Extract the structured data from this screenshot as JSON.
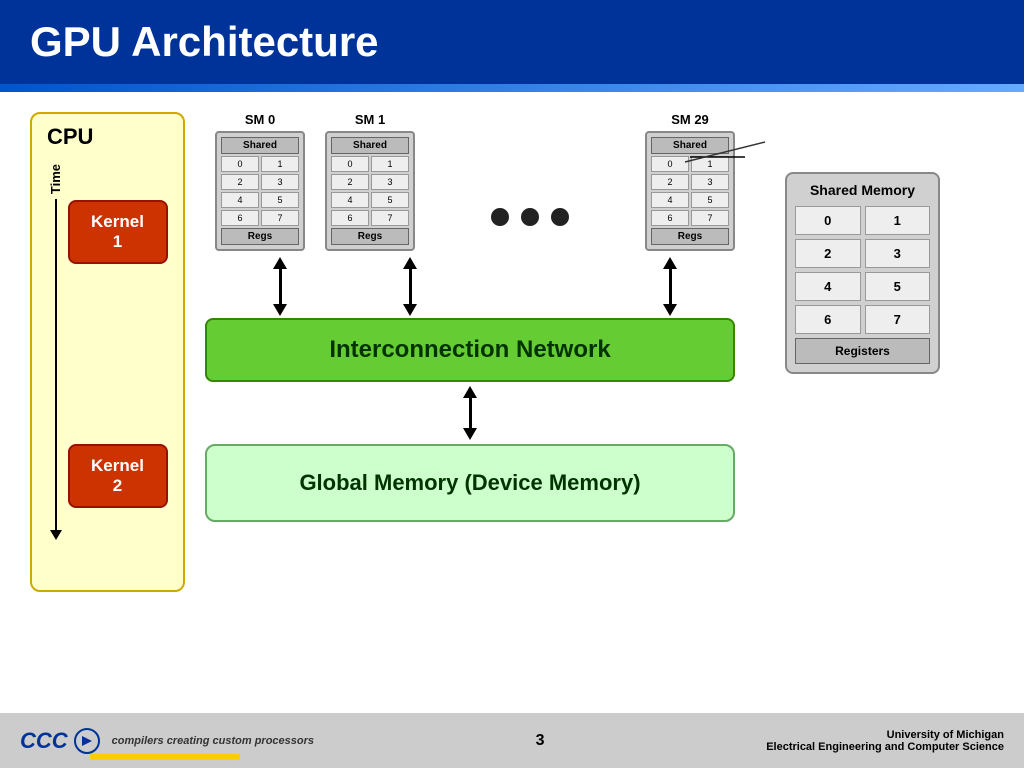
{
  "header": {
    "title": "GPU Architecture"
  },
  "cpu": {
    "label": "CPU",
    "time_label": "Time",
    "kernel1": "Kernel 1",
    "kernel2": "Kernel 2"
  },
  "sm_units": [
    {
      "label": "SM 0",
      "shared": "Shared",
      "cells": [
        "0",
        "1",
        "2",
        "3",
        "4",
        "5",
        "6",
        "7"
      ],
      "regs": "Regs"
    },
    {
      "label": "SM 1",
      "shared": "Shared",
      "cells": [
        "0",
        "1",
        "2",
        "3",
        "4",
        "5",
        "6",
        "7"
      ],
      "regs": "Regs"
    },
    {
      "label": "SM 29",
      "shared": "Shared",
      "cells": [
        "0",
        "1",
        "2",
        "3",
        "4",
        "5",
        "6",
        "7"
      ],
      "regs": "Regs"
    }
  ],
  "interconnect": {
    "label": "Interconnection Network"
  },
  "global_memory": {
    "label": "Global Memory (Device Memory)"
  },
  "shared_memory_box": {
    "title": "Shared Memory",
    "cells": [
      "0",
      "1",
      "2",
      "3",
      "4",
      "5",
      "6",
      "7"
    ],
    "regs_label": "Registers"
  },
  "footer": {
    "logo_text": "CCC",
    "logo_sub": "compilers creating custom processors",
    "page_number": "3",
    "university_line1": "University of Michigan",
    "university_line2": "Electrical Engineering and Computer Science"
  }
}
